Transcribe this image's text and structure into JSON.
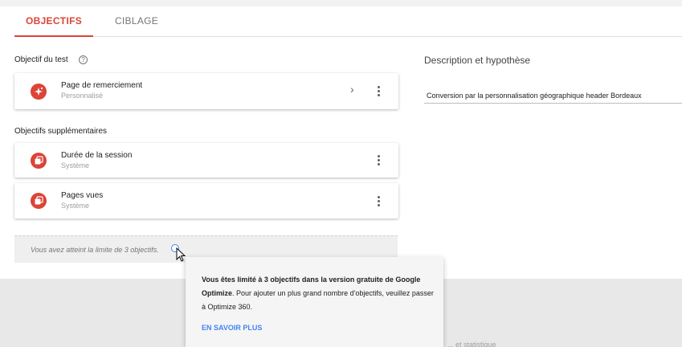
{
  "tabs": [
    {
      "label": "OBJECTIFS",
      "active": true
    },
    {
      "label": "CIBLAGE",
      "active": false
    }
  ],
  "objective": {
    "section_label": "Objectif du test",
    "help_icon": "?",
    "card": {
      "title": "Page de remerciement",
      "subtitle": "Personnalisé",
      "chevron": "›"
    }
  },
  "additional": {
    "section_label": "Objectifs supplémentaires",
    "cards": [
      {
        "title": "Durée de la session",
        "subtitle": "Système"
      },
      {
        "title": "Pages vues",
        "subtitle": "Système"
      }
    ]
  },
  "limit": {
    "text": "Vous avez atteint la limite de 3 objectifs."
  },
  "description": {
    "title": "Description et hypothèse",
    "value": "Conversion par la personnalisation géographique header Bordeaux"
  },
  "tooltip": {
    "bold_part": "Vous êtes limité à 3 objectifs dans la version gratuite de Google Optimize",
    "rest": ". Pour ajouter un plus grand nombre d'objectifs, veuillez passer à Optimize 360.",
    "link": "EN SAVOIR PLUS"
  },
  "faded_text": "... et statistique",
  "colors": {
    "accent": "#db4437",
    "link": "#4285f4"
  }
}
